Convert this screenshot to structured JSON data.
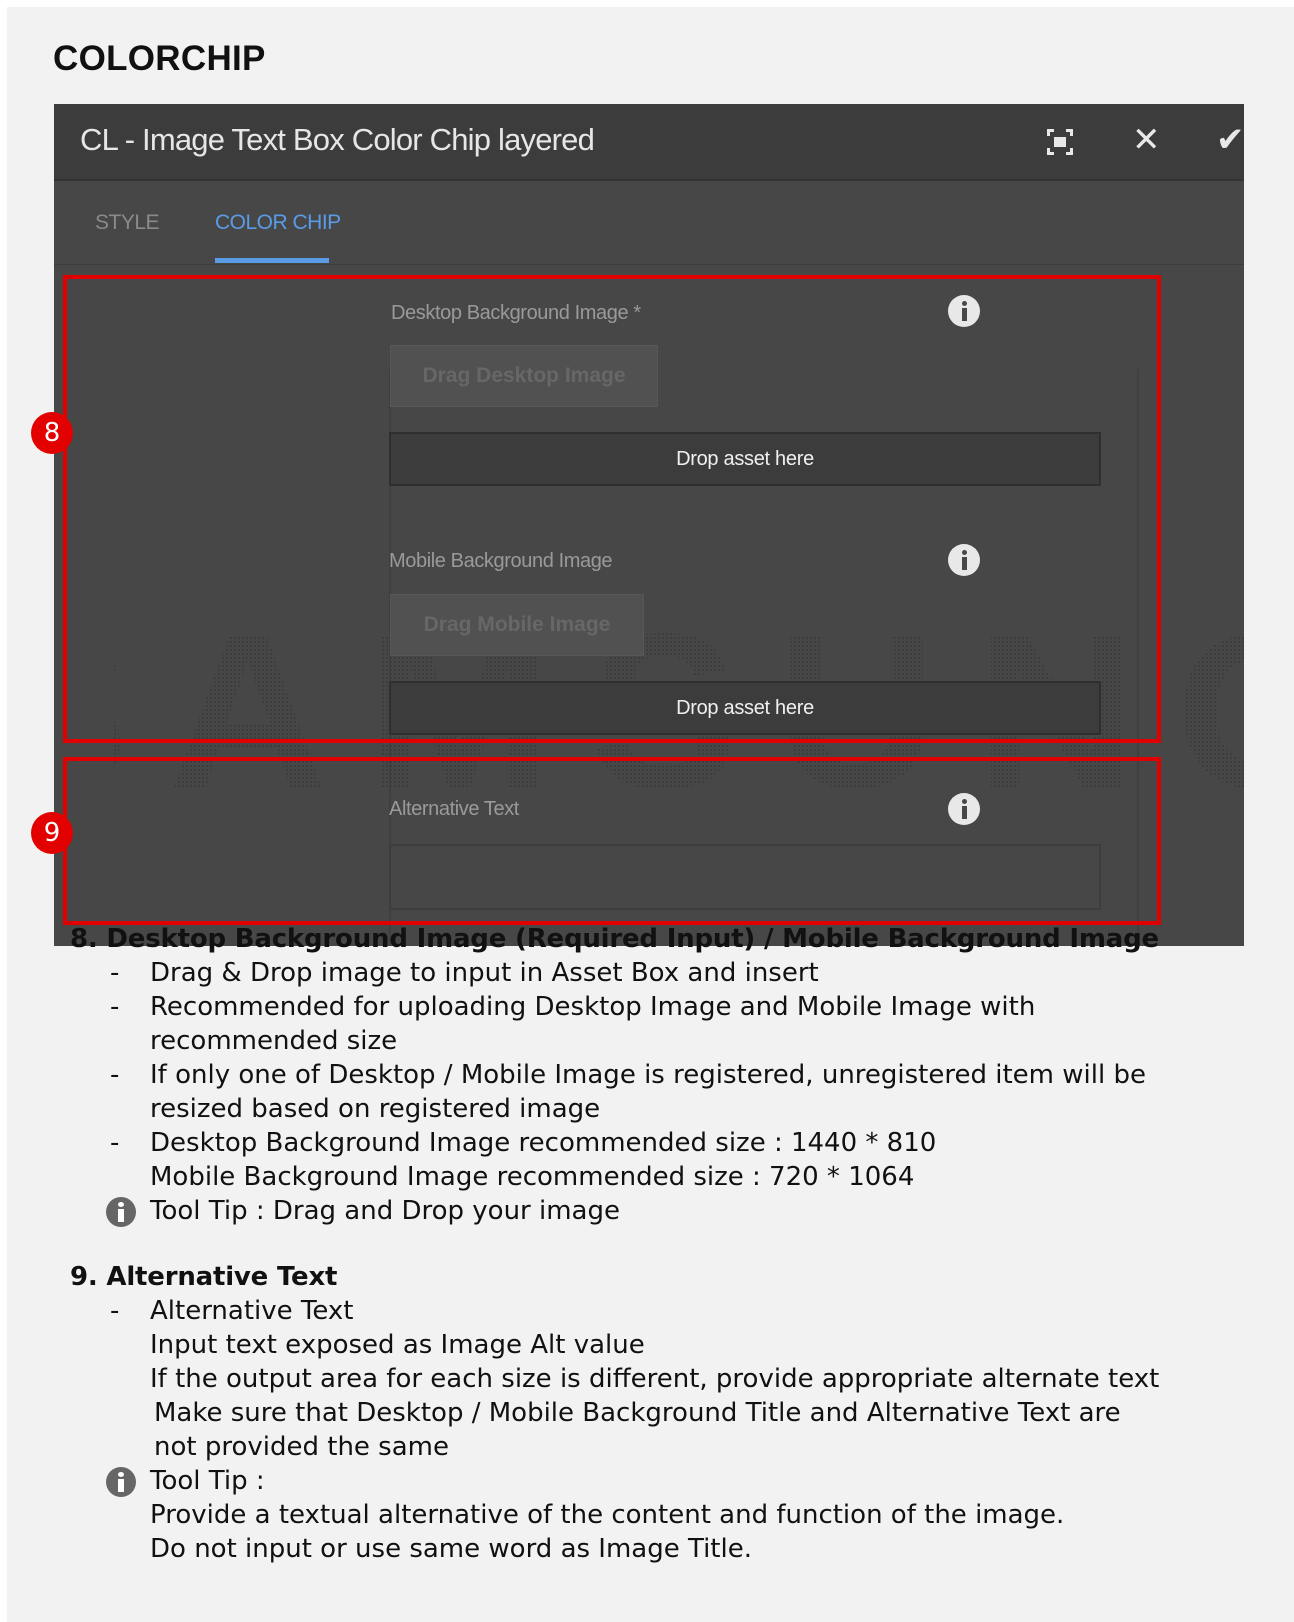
{
  "page_title": "COLORCHIP",
  "dialog": {
    "title": "CL - Image Text Box Color Chip layered",
    "tabs": [
      {
        "label": "STYLE"
      },
      {
        "label": "COLOR CHIP"
      }
    ],
    "desktop_label": "Desktop Background Image *",
    "desktop_drag_button": "Drag Desktop Image",
    "drop_label_1": "Drop asset here",
    "mobile_label": "Mobile Background Image",
    "mobile_drag_button": "Drag Mobile Image",
    "drop_label_2": "Drop asset here",
    "alt_label": "Alternative Text",
    "watermark": "SAMSUNG",
    "icons": [
      "fullscreen-icon",
      "close-icon",
      "check-icon",
      "info-icon"
    ]
  },
  "callouts": {
    "badge_8": "8",
    "badge_9": "9"
  },
  "notes": {
    "section8": {
      "title": "8. Desktop Background Image (Required Input) / Mobile Background Image",
      "bullets": [
        "Drag & Drop image to input in Asset Box and insert",
        "Recommended for uploading Desktop Image and Mobile Image with",
        "recommended size",
        "If only one of Desktop / Mobile Image is registered, unregistered item will be",
        "resized based on registered image",
        "Desktop Background Image recommended size : 1440 * 810",
        "Mobile Background Image recommended size : 720 * 1064"
      ],
      "tip": "Tool Tip : Drag and Drop your image"
    },
    "section9": {
      "title": "9. Alternative Text",
      "lines": [
        "Alternative Text",
        "Input text exposed as Image Alt value",
        "If the output area for each size is different, provide appropriate alternate text",
        "Make sure that Desktop / Mobile Background Title and Alternative Text are",
        "not provided the same"
      ],
      "tip": "Tool Tip :",
      "tip_lines": [
        "Provide a textual alternative of the content and function of the image.",
        "Do not input or use same word as Image Title."
      ]
    }
  },
  "colors": {
    "accent_tab": "#5a9be6",
    "callout_red": "#e00000",
    "dialog_bg": "#474747"
  }
}
